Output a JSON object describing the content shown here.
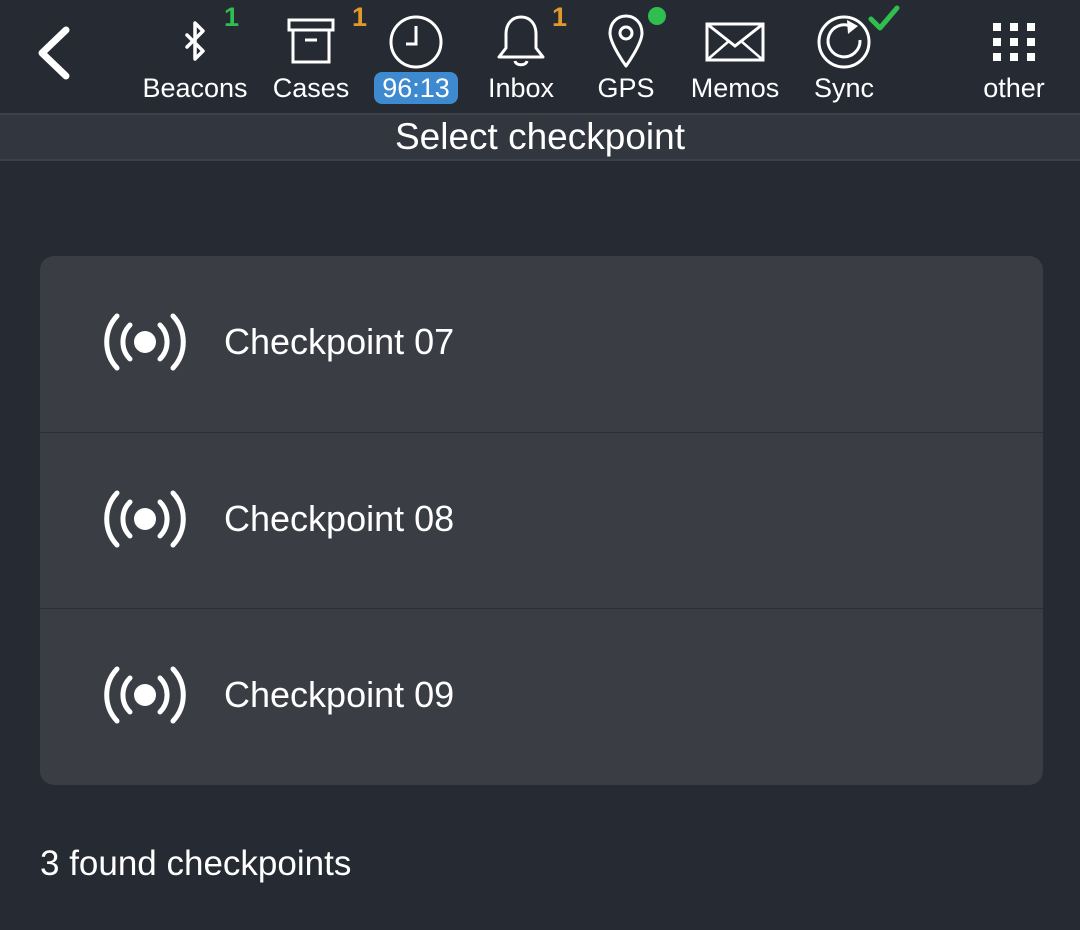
{
  "screen_title": "Select checkpoint",
  "toolbar": {
    "beacons": {
      "label": "Beacons",
      "badge": "1",
      "badge_color": "#2fbf4f",
      "icon": "bluetooth-icon"
    },
    "cases": {
      "label": "Cases",
      "badge": "1",
      "badge_color": "#e09a2c",
      "icon": "archive-box-icon"
    },
    "timer": {
      "label": "96:13",
      "pill_color": "#3d8ad0",
      "icon": "clock-icon"
    },
    "inbox": {
      "label": "Inbox",
      "badge": "1",
      "badge_color": "#e09a2c",
      "icon": "bell-icon"
    },
    "gps": {
      "label": "GPS",
      "status_color": "#2fbf4f",
      "icon": "map-pin-icon"
    },
    "memos": {
      "label": "Memos",
      "icon": "envelope-icon"
    },
    "sync": {
      "label": "Sync",
      "status_color": "#2fbf4f",
      "icon": "sync-icon"
    },
    "other": {
      "label": "other",
      "icon": "grid-menu-icon"
    }
  },
  "checkpoints": [
    {
      "label": "Checkpoint 07",
      "icon": "beacon-signal-icon"
    },
    {
      "label": "Checkpoint 08",
      "icon": "beacon-signal-icon"
    },
    {
      "label": "Checkpoint 09",
      "icon": "beacon-signal-icon"
    }
  ],
  "footer": {
    "count_text": "3 found checkpoints"
  },
  "colors": {
    "background": "#262a33",
    "card": "#3a3d44",
    "title_bar": "#32363f",
    "text": "#ffffff"
  }
}
